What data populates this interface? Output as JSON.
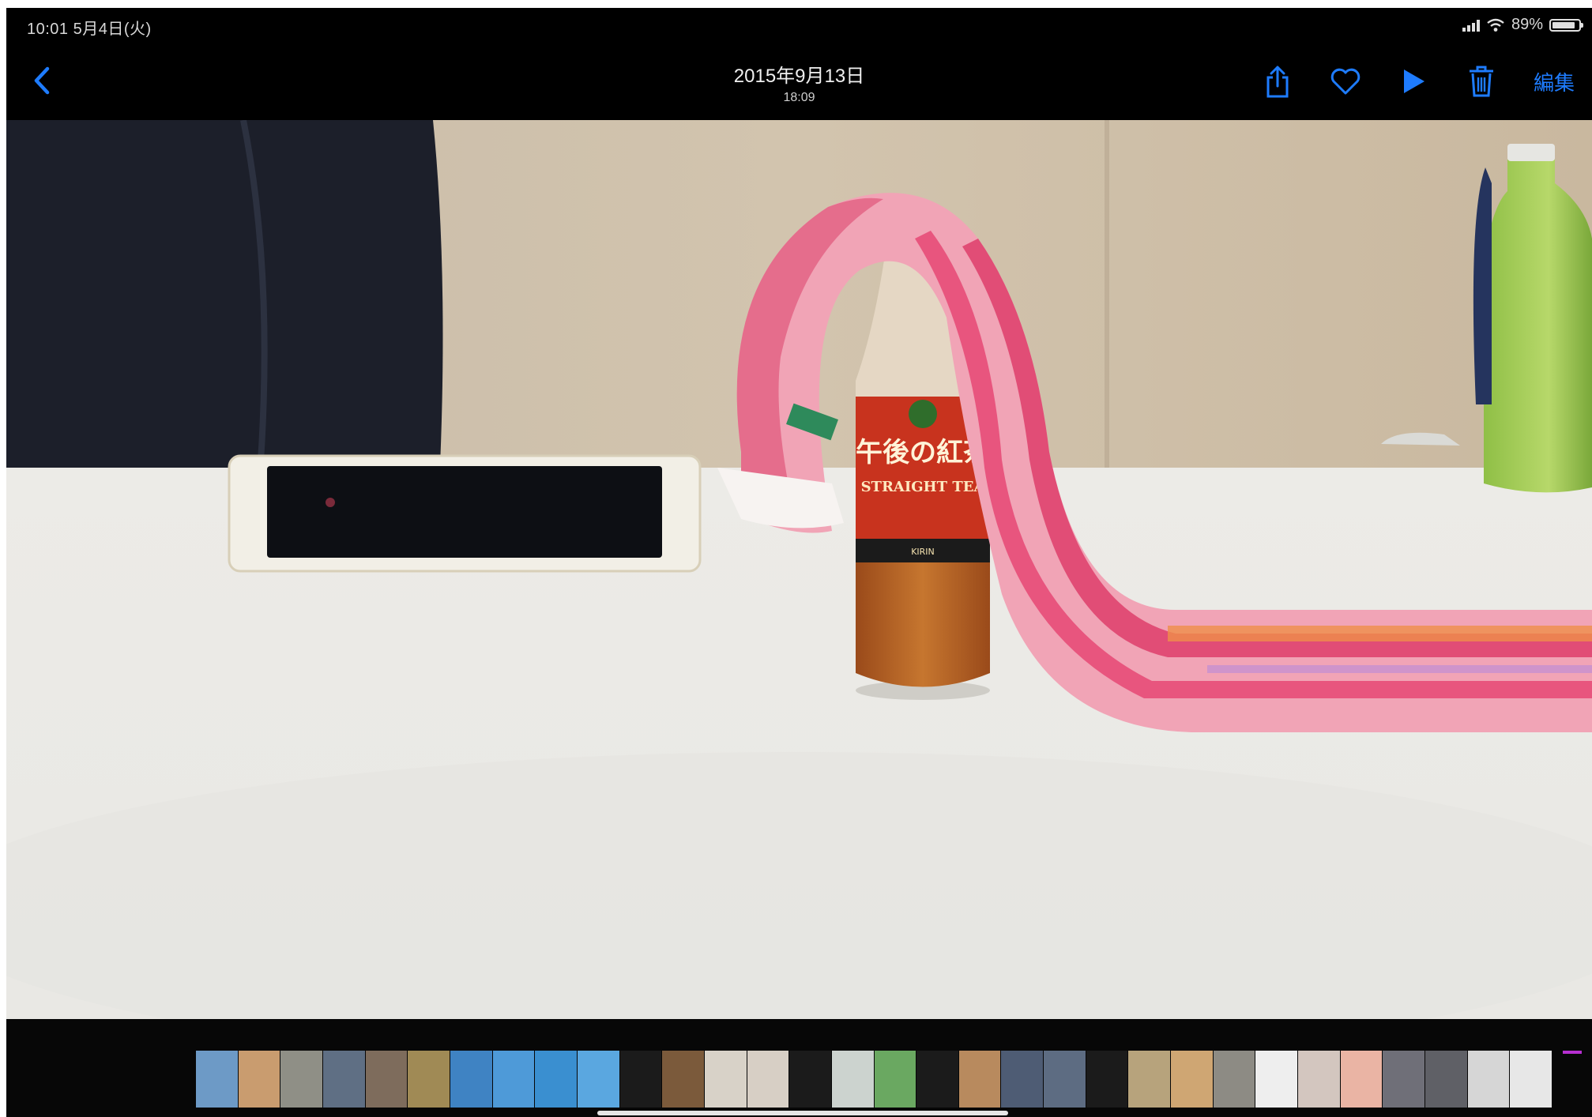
{
  "status": {
    "time_date": "10:01  5月4日(火)",
    "battery": "89%",
    "battery_level": 0.89
  },
  "nav": {
    "back_icon": "chevron-left-icon",
    "date": "2015年9月13日",
    "time": "18:09",
    "share_icon": "share-icon",
    "favorite_icon": "heart-icon",
    "play_icon": "play-icon",
    "delete_icon": "trash-icon",
    "edit_label": "編集"
  },
  "photo": {
    "bottle_label_jp": "午後の紅茶",
    "bottle_label_en": "STRAIGHT TEA",
    "bottle_brand": "KIRIN"
  },
  "colors": {
    "accent": "#1e7cff",
    "background": "#000000"
  },
  "filmstrip": {
    "thumbnails": [
      "#6d9ac6",
      "#c99c6f",
      "#8f8f86",
      "#5f6f84",
      "#7e6c5c",
      "#a08a55",
      "#3f83c3",
      "#4e9ad8",
      "#3a8fd0",
      "#5aa7e0",
      "#1b1b1b",
      "#7b5a3b",
      "#d8d2c8",
      "#d7cfc5",
      "#1b1b1b",
      "#ccd3cf",
      "#6aa861",
      "#1b1b1b",
      "#b88a5e",
      "#4e5c74",
      "#5d6c82",
      "#1b1b1b",
      "#b7a37c",
      "#cfa673",
      "#8d8b84",
      "#eeeeee",
      "#d3c6bf",
      "#eab4a4",
      "#6f6f78",
      "#5f6066",
      "#d6d6d6",
      "#e7e7e7"
    ]
  }
}
